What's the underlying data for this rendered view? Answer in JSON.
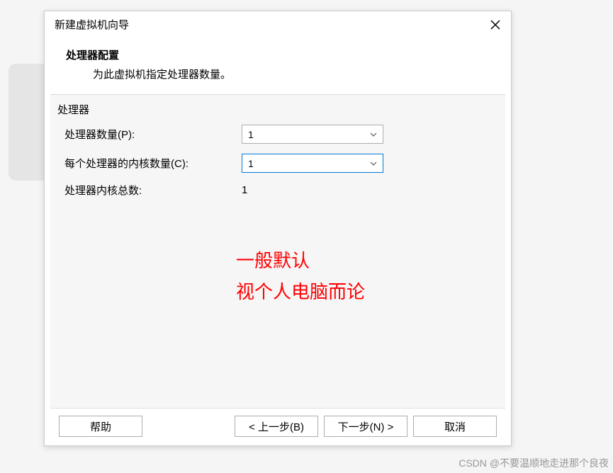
{
  "dialog": {
    "title": "新建虚拟机向导"
  },
  "header": {
    "title": "处理器配置",
    "subtitle": "为此虚拟机指定处理器数量。"
  },
  "group": {
    "label": "处理器"
  },
  "fields": {
    "processor_count": {
      "label": "处理器数量(P):",
      "value": "1"
    },
    "cores_per_processor": {
      "label": "每个处理器的内核数量(C):",
      "value": "1"
    },
    "total_cores": {
      "label": "处理器内核总数:",
      "value": "1"
    }
  },
  "annotation": {
    "line1": "一般默认",
    "line2": "视个人电脑而论"
  },
  "buttons": {
    "help": "帮助",
    "back": "< 上一步(B)",
    "next": "下一步(N) >",
    "cancel": "取消"
  },
  "watermark": "CSDN @不要温顺地走进那个良夜"
}
